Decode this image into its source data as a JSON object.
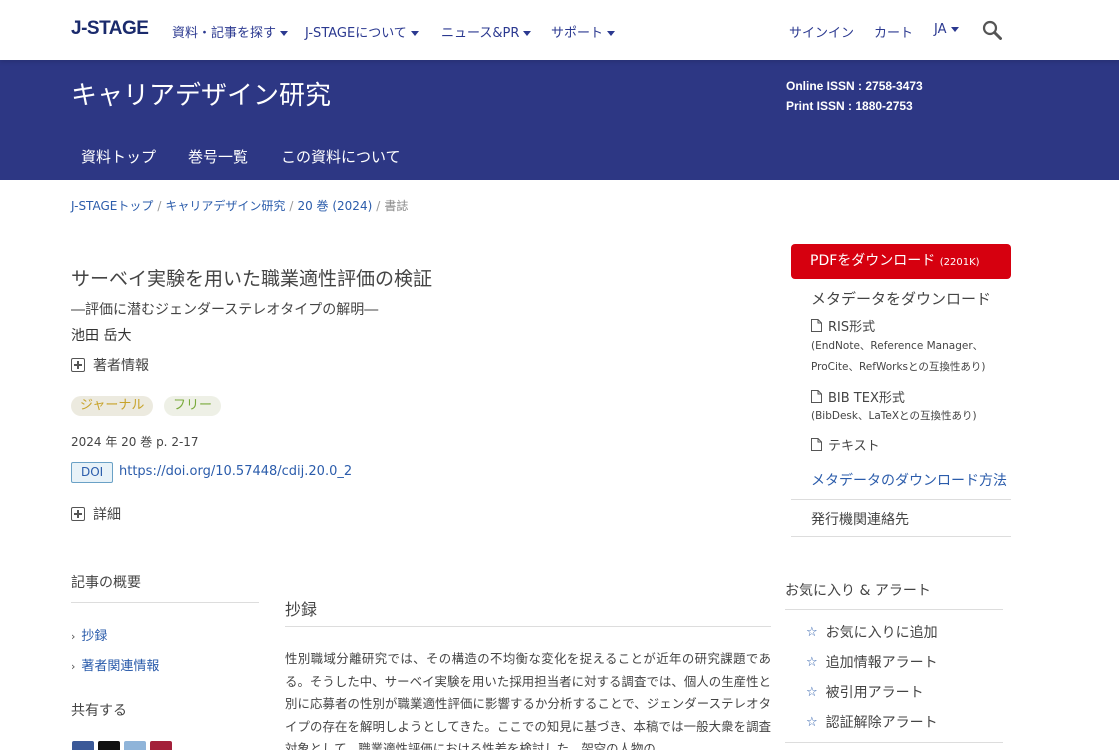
{
  "header": {
    "logo": "J-STAGE",
    "menu": [
      {
        "label": "資料・記事を探す"
      },
      {
        "label": "J-STAGEについて"
      },
      {
        "label": "ニュース&PR"
      },
      {
        "label": "サポート"
      }
    ],
    "signin": "サインイン",
    "cart": "カート",
    "lang": "JA",
    "search_icon": "search-icon"
  },
  "journal": {
    "title": "キャリアデザイン研究",
    "online_issn": "Online ISSN : 2758-3473",
    "print_issn": "Print ISSN : 1880-2753",
    "nav": [
      "資料トップ",
      "巻号一覧",
      "この資料について"
    ]
  },
  "breadcrumb": {
    "items": [
      "J-STAGEトップ",
      "キャリアデザイン研究",
      "20 巻 (2024)"
    ],
    "current": "書誌"
  },
  "article": {
    "title": "サーベイ実験を用いた職業適性評価の検証",
    "subtitle": "―評価に潜むジェンダーステレオタイプの解明―",
    "author": "池田 岳大",
    "author_info": "著者情報",
    "badges": [
      "ジャーナル",
      "フリー"
    ],
    "volume": "2024 年 20 巻 p. 2-17",
    "doi_label": "DOI",
    "doi": "https://doi.org/10.57448/cdij.20.0_2",
    "details": "詳細"
  },
  "sidebar": {
    "overview": "記事の概要",
    "links": [
      "抄録",
      "著者関連情報"
    ],
    "share": "共有する"
  },
  "abstract": {
    "heading": "抄録",
    "text": "性別職域分離研究では、その構造の不均衡な変化を捉えることが近年の研究課題である。そうした中、サーベイ実験を用いた採用担当者に対する調査では、個人の生産性と別に応募者の性別が職業適性評価に影響するか分析することで、ジェンダーステレオタイプの存在を解明しようとしてきた。ここでの知見に基づき、本稿では一般大衆を調査対象として、職業適性評価における性差を検討した。架空の人物の"
  },
  "rightcol": {
    "pdf_label": "PDFをダウンロード",
    "pdf_size": "(2201K)",
    "meta_heading": "メタデータをダウンロード",
    "downloads": [
      {
        "label": "RIS形式",
        "note1": "(EndNote、Reference Manager、",
        "note2": "ProCite、RefWorksとの互換性あり)"
      },
      {
        "label": "BIB TEX形式",
        "note1": "(BibDesk、LaTeXとの互換性あり)"
      },
      {
        "label": "テキスト"
      }
    ],
    "meta_how": "メタデータのダウンロード方法",
    "publisher_contact": "発行機関連絡先",
    "fav_heading": "お気に入り & アラート",
    "fav_items": [
      "お気に入りに追加",
      "追加情報アラート",
      "被引用アラート",
      "認証解除アラート"
    ]
  },
  "colors": {
    "banner": "#2d3784",
    "link": "#2b5cab",
    "pdf": "#d6000f"
  }
}
